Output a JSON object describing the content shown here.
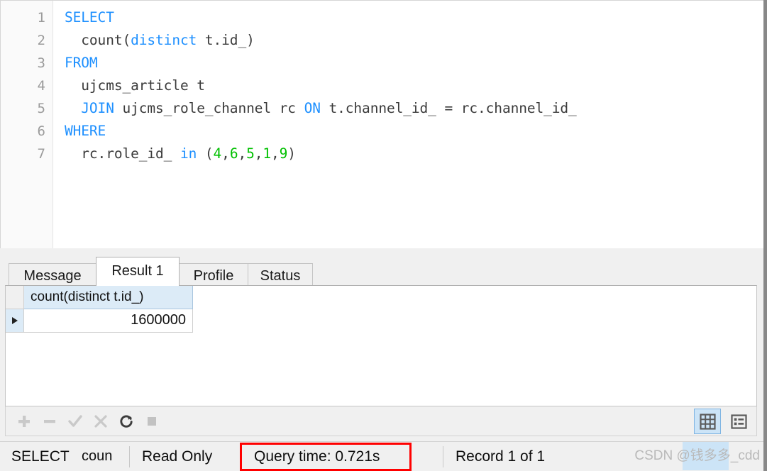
{
  "editor": {
    "lines": [
      {
        "number": "1",
        "tokens": [
          {
            "t": "SELECT",
            "c": "kw"
          }
        ]
      },
      {
        "number": "2",
        "tokens": [
          {
            "t": "  count(",
            "c": "pl"
          },
          {
            "t": "distinct",
            "c": "kw"
          },
          {
            "t": " t.id_)",
            "c": "pl"
          }
        ]
      },
      {
        "number": "3",
        "tokens": [
          {
            "t": "FROM",
            "c": "kw"
          }
        ]
      },
      {
        "number": "4",
        "tokens": [
          {
            "t": "  ujcms_article t",
            "c": "pl"
          }
        ]
      },
      {
        "number": "5",
        "tokens": [
          {
            "t": "  ",
            "c": "pl"
          },
          {
            "t": "JOIN",
            "c": "kw"
          },
          {
            "t": " ujcms_role_channel rc ",
            "c": "pl"
          },
          {
            "t": "ON",
            "c": "kw"
          },
          {
            "t": " t.channel_id_ = rc.channel_id_",
            "c": "pl"
          }
        ]
      },
      {
        "number": "6",
        "tokens": [
          {
            "t": "WHERE",
            "c": "kw"
          }
        ]
      },
      {
        "number": "7",
        "tokens": [
          {
            "t": "  rc.role_id_ ",
            "c": "pl"
          },
          {
            "t": "in",
            "c": "kw"
          },
          {
            "t": " (",
            "c": "pl"
          },
          {
            "t": "4",
            "c": "num"
          },
          {
            "t": ",",
            "c": "pl"
          },
          {
            "t": "6",
            "c": "num"
          },
          {
            "t": ",",
            "c": "pl"
          },
          {
            "t": "5",
            "c": "num"
          },
          {
            "t": ",",
            "c": "pl"
          },
          {
            "t": "1",
            "c": "num"
          },
          {
            "t": ",",
            "c": "pl"
          },
          {
            "t": "9",
            "c": "num"
          },
          {
            "t": ")",
            "c": "pl"
          }
        ]
      }
    ],
    "colors": {
      "keyword": "#1e90ff",
      "number": "#00c000",
      "plain": "#3b3b3b",
      "gutter_text": "#9b9b9b"
    }
  },
  "tabs": [
    {
      "label": "Message",
      "active": false
    },
    {
      "label": "Result 1",
      "active": true
    },
    {
      "label": "Profile",
      "active": false
    },
    {
      "label": "Status",
      "active": false
    }
  ],
  "grid": {
    "columns": [
      "count(distinct t.id_)"
    ],
    "rows": [
      {
        "cells": [
          "1600000"
        ],
        "current": true
      }
    ]
  },
  "toolbar": {
    "buttons": [
      {
        "name": "add-record-button",
        "glyph": "+",
        "enabled": false
      },
      {
        "name": "delete-record-button",
        "glyph": "−",
        "enabled": false
      },
      {
        "name": "apply-changes-button",
        "glyph": "✓",
        "enabled": false
      },
      {
        "name": "cancel-changes-button",
        "glyph": "✕",
        "enabled": false
      },
      {
        "name": "refresh-button",
        "glyph": "⟳",
        "enabled": true
      },
      {
        "name": "stop-button",
        "glyph": "■",
        "enabled": false
      }
    ],
    "view_modes": [
      {
        "name": "grid-view-button",
        "selected": true
      },
      {
        "name": "form-view-button",
        "selected": false
      }
    ]
  },
  "statusbar": {
    "statement": "SELECT",
    "statement_detail": "coun",
    "mode": "Read Only",
    "query_time": "Query time: 0.721s",
    "record_position": "Record 1 of 1",
    "highlight_color": "#ff0000"
  },
  "watermark": {
    "text": "CSDN @钱多多_cdd"
  }
}
